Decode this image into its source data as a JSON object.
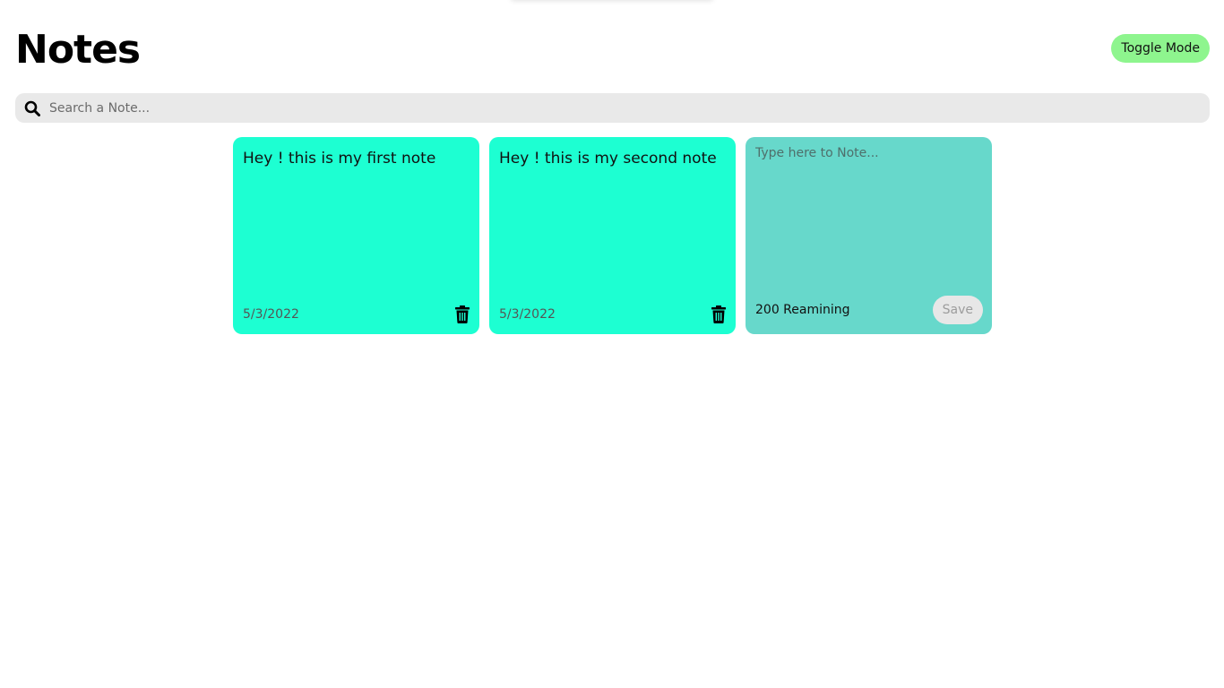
{
  "header": {
    "title": "Notes",
    "toggle_label": "Toggle Mode"
  },
  "search": {
    "icon": "search-icon",
    "placeholder": "Search a Note..."
  },
  "notes": [
    {
      "text": "Hey ! this is my first note",
      "date": "5/3/2022",
      "delete_icon": "trash-icon"
    },
    {
      "text": "Hey ! this is my second note",
      "date": "5/3/2022",
      "delete_icon": "trash-icon"
    }
  ],
  "new_note": {
    "placeholder": "Type here to Note...",
    "remaining": "200 Reamining",
    "save_label": "Save"
  },
  "colors": {
    "note_bg": "#1dffd2",
    "new_note_bg": "#67d8cb",
    "toggle_bg": "#8ef58e",
    "search_bg": "#e9e9e9"
  }
}
